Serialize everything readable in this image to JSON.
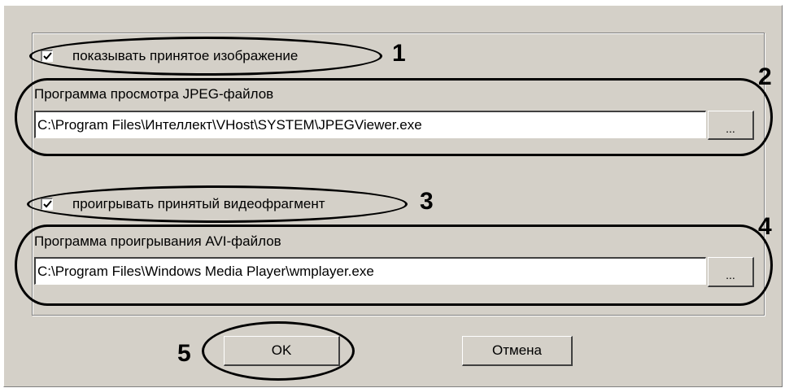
{
  "checkbox_show_image": {
    "label": "показывать принятое изображение",
    "checked": true
  },
  "jpeg_viewer": {
    "label": "Программа просмотра JPEG-файлов",
    "path": "C:\\Program Files\\Интеллект\\VHost\\SYSTEM\\JPEGViewer.exe",
    "browse_label": "..."
  },
  "checkbox_play_video": {
    "label": "проигрывать принятый видеофрагмент",
    "checked": true
  },
  "avi_player": {
    "label": "Программа проигрывания AVI-файлов",
    "path": "C:\\Program Files\\Windows Media Player\\wmplayer.exe",
    "browse_label": "..."
  },
  "buttons": {
    "ok_label": "OK",
    "cancel_label": "Отмена"
  },
  "callouts": [
    "1",
    "2",
    "3",
    "4",
    "5"
  ],
  "colors": {
    "dialog_bg": "#d4d0c8",
    "annotation": "#000000"
  }
}
